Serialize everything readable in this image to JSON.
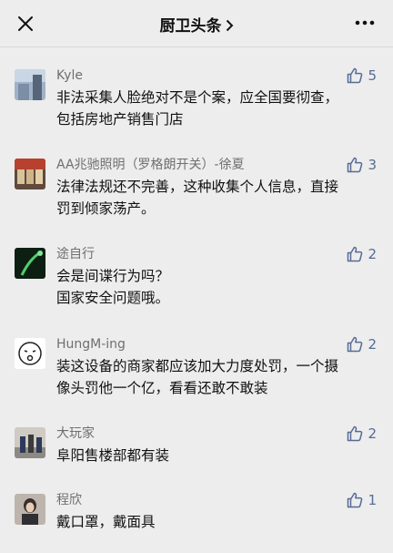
{
  "header": {
    "title": "厨卫头条",
    "close_icon": "close-icon",
    "more_icon": "more-icon"
  },
  "comments": [
    {
      "user": "Kyle",
      "likes": "5",
      "text": "非法采集人脸绝对不是个案，应全国要彻查，\n包括房地产销售门店"
    },
    {
      "user": "AA兆驰照明（罗格朗开关）-徐夏",
      "likes": "3",
      "text": "法律法规还不完善，这种收集个人信息，直接\n罚到倾家荡产。"
    },
    {
      "user": "途自行",
      "likes": "2",
      "text": "会是间谍行为吗？\n国家安全问题哦。"
    },
    {
      "user": "HungM-ing",
      "likes": "2",
      "text": "装这设备的商家都应该加大力度处罚，一个摄\n像头罚他一个亿，看看还敢不敢装"
    },
    {
      "user": "大玩家",
      "likes": "2",
      "text": "阜阳售楼部都有装"
    },
    {
      "user": "程欣",
      "likes": "1",
      "text": "戴口罩，戴面具"
    }
  ],
  "colors": {
    "background": "#ededed",
    "link": "#576b95",
    "username": "#6f6f72"
  }
}
